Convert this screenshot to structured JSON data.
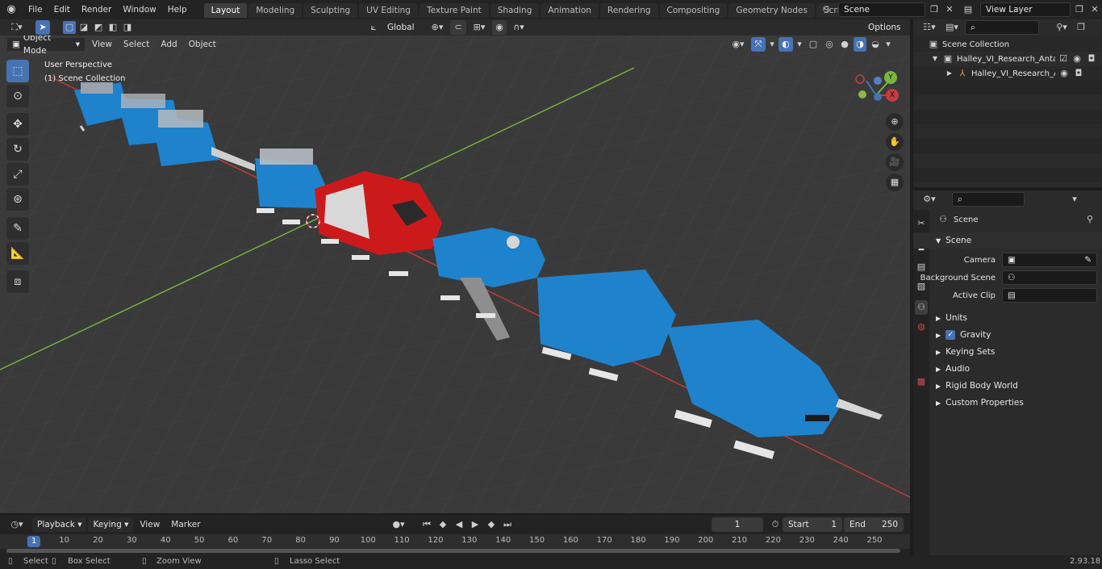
{
  "menu": [
    "File",
    "Edit",
    "Render",
    "Window",
    "Help"
  ],
  "workspaces": [
    "Layout",
    "Modeling",
    "Sculpting",
    "UV Editing",
    "Texture Paint",
    "Shading",
    "Animation",
    "Rendering",
    "Compositing",
    "Geometry Nodes",
    "Scripting"
  ],
  "active_workspace": "Layout",
  "scene_field": "Scene",
  "view_layer_field": "View Layer",
  "tool_header": {
    "transform_orientation": "Global",
    "options_label": "Options"
  },
  "viewport_header": {
    "mode": "Object Mode",
    "menus": [
      "View",
      "Select",
      "Add",
      "Object"
    ]
  },
  "viewport_overlay": {
    "view_name": "User Perspective",
    "collection": "(1) Scene Collection"
  },
  "gizmo_axes": {
    "x": "X",
    "y": "Y",
    "z": "Z"
  },
  "outliner": {
    "root": "Scene Collection",
    "items": [
      {
        "label": "Halley_VI_Research_Antarctic"
      },
      {
        "label": "Halley_VI_Research_Antz"
      }
    ]
  },
  "properties": {
    "context": "Scene",
    "section": "Scene",
    "fields": [
      {
        "label": "Camera",
        "value": ""
      },
      {
        "label": "Background Scene",
        "value": ""
      },
      {
        "label": "Active Clip",
        "value": ""
      }
    ],
    "panels": [
      "Units",
      "Gravity",
      "Keying Sets",
      "Audio",
      "Rigid Body World",
      "Custom Properties"
    ]
  },
  "timeline": {
    "menus": [
      "Playback",
      "Keying",
      "View",
      "Marker"
    ],
    "current_frame": "1",
    "start_label": "Start",
    "start": "1",
    "end_label": "End",
    "end": "250",
    "ticks": [
      "1",
      "10",
      "20",
      "30",
      "40",
      "50",
      "60",
      "70",
      "80",
      "90",
      "100",
      "110",
      "120",
      "130",
      "140",
      "150",
      "160",
      "170",
      "180",
      "190",
      "200",
      "210",
      "220",
      "230",
      "240",
      "250"
    ]
  },
  "statusbar": {
    "items": [
      "Select",
      "Box Select",
      "Zoom View",
      "Lasso Select"
    ],
    "version": "2.93.18"
  },
  "colors": {
    "module_blue": "#1f82cc",
    "module_red": "#cc1a1a",
    "accent": "#4772b3",
    "axis_x": "#c83b3b",
    "axis_y": "#7ab83a"
  }
}
